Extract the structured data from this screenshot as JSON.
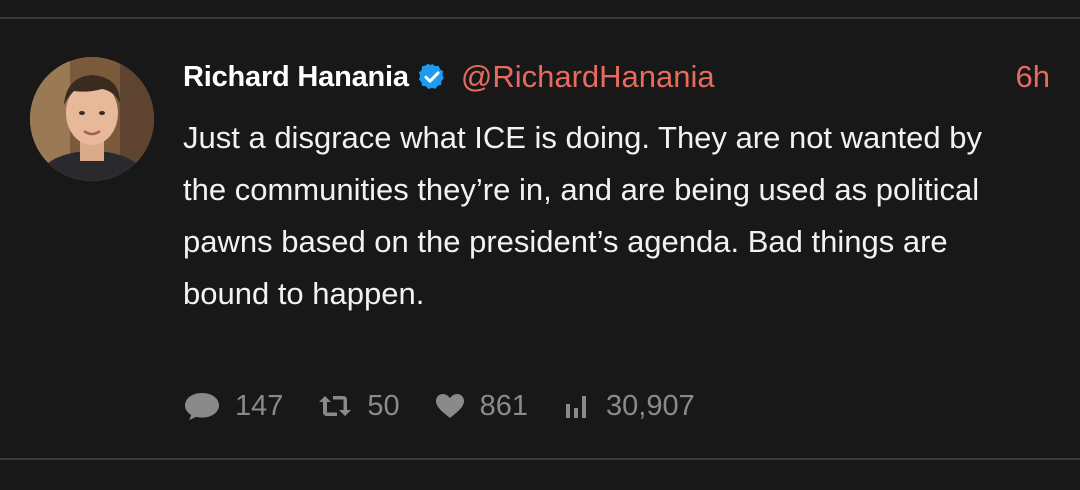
{
  "tweet": {
    "author": {
      "display_name": "Richard Hanania",
      "handle": "@RichardHanania",
      "verified": true,
      "avatar_icon": "person-photo-avatar"
    },
    "timestamp": "6h",
    "text": "Just a disgrace what ICE is doing. They are not wanted by the communities they’re in, and are being used as political pawns based on the president’s agenda. Bad things are bound to happen.",
    "stats": {
      "replies": "147",
      "retweets": "50",
      "likes": "861",
      "views": "30,907"
    },
    "icons": {
      "reply": "comment-bubble-icon",
      "retweet": "retweet-icon",
      "like": "heart-icon",
      "views": "bar-chart-icon",
      "verified": "verified-badge-icon"
    }
  },
  "colors": {
    "background": "#181818",
    "accent": "#e86a5e",
    "verified": "#1d9bf0",
    "muted": "#8a8a8a",
    "text": "#f2f2f2"
  }
}
